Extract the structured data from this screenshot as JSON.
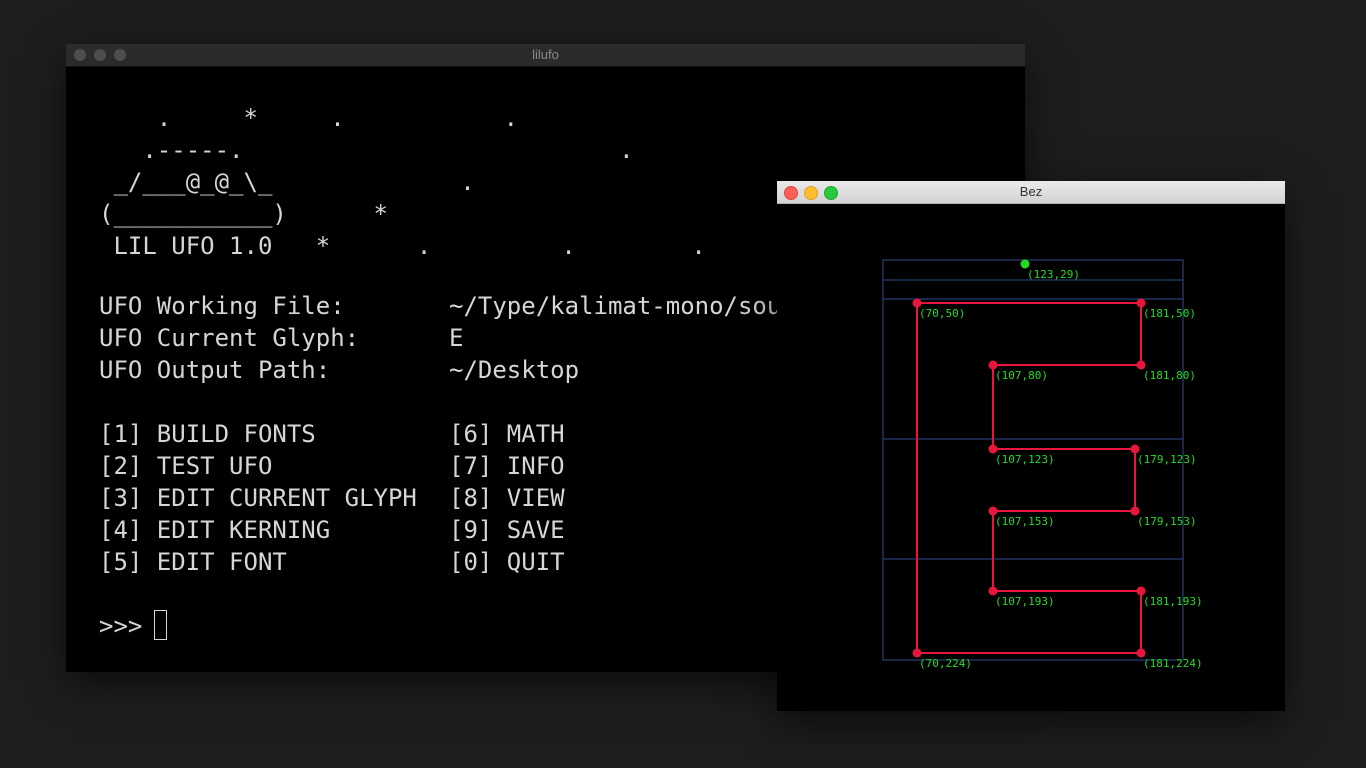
{
  "terminal": {
    "title": "lilufo",
    "art": [
      "    .     *     .           .",
      "   .-----.                          .",
      " _/___@_@_\\_             .",
      "(___________)      *",
      " LIL UFO 1.0   *      .         .        ."
    ],
    "info": [
      {
        "label": "UFO Working File:",
        "value": "~/Type/kalimat-mono/sour"
      },
      {
        "label": "UFO Current Glyph:",
        "value": "E"
      },
      {
        "label": "UFO Output Path:",
        "value": "~/Desktop"
      }
    ],
    "menu_left": [
      "[1] BUILD FONTS",
      "[2] TEST UFO",
      "[3] EDIT CURRENT GLYPH",
      "[4] EDIT KERNING",
      "[5] EDIT FONT"
    ],
    "menu_right": [
      "[6] MATH",
      "[7] INFO",
      "[8] VIEW",
      "[9] SAVE",
      "[0] QUIT"
    ],
    "prompt": ">>>"
  },
  "bez": {
    "title": "Bez",
    "colors": {
      "contour": "#e8163c",
      "label": "#22dd22",
      "guide": "#2a3d75",
      "anchor": "#22dd22"
    },
    "anchor": {
      "label": "(123,29)"
    },
    "points": [
      {
        "label": "(70,50)"
      },
      {
        "label": "(181,50)"
      },
      {
        "label": "(107,80)"
      },
      {
        "label": "(181,80)"
      },
      {
        "label": "(107,123)"
      },
      {
        "label": "(179,123)"
      },
      {
        "label": "(107,153)"
      },
      {
        "label": "(179,153)"
      },
      {
        "label": "(107,193)"
      },
      {
        "label": "(181,193)"
      },
      {
        "label": "(70,224)"
      },
      {
        "label": "(181,224)"
      }
    ]
  }
}
